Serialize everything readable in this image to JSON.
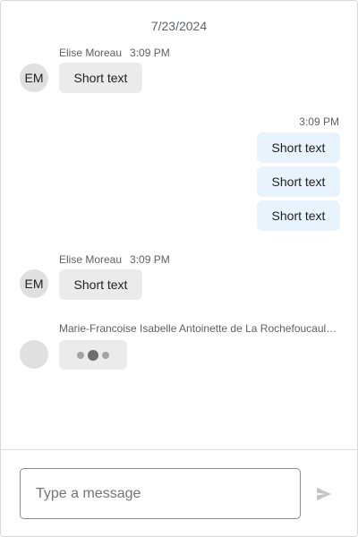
{
  "date_separator": "7/23/2024",
  "messages": [
    {
      "sender": "Elise Moreau",
      "initials": "EM",
      "time": "3:09 PM",
      "bubbles": [
        "Short text"
      ]
    },
    {
      "time": "3:09 PM",
      "bubbles": [
        "Short text",
        "Short text",
        "Short text"
      ]
    },
    {
      "sender": "Elise Moreau",
      "initials": "EM",
      "time": "3:09 PM",
      "bubbles": [
        "Short text"
      ]
    }
  ],
  "typing": {
    "sender": "Marie-Francoise Isabelle Antoinette de La Rochefoucauld-Montmorency"
  },
  "composer": {
    "placeholder": "Type a message",
    "send_icon": "send-icon"
  },
  "colors": {
    "incoming_bubble": "#ebebeb",
    "outgoing_bubble": "#e8f4fd",
    "avatar_bg": "#e0e0e0",
    "send_icon": "#c4c4c4"
  }
}
